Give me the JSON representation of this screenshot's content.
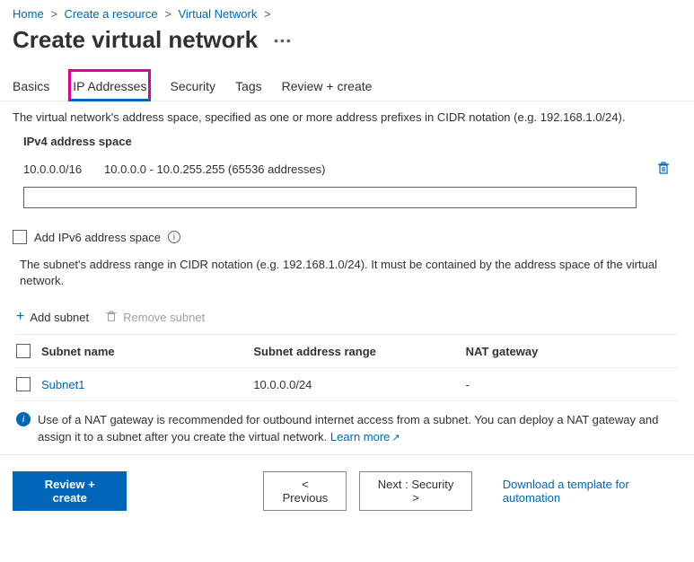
{
  "breadcrumb": {
    "items": [
      "Home",
      "Create a resource",
      "Virtual Network"
    ]
  },
  "page": {
    "title": "Create virtual network"
  },
  "tabs": {
    "items": [
      "Basics",
      "IP Addresses",
      "Security",
      "Tags",
      "Review + create"
    ],
    "active_index": 1
  },
  "ip_section": {
    "description": "The virtual network's address space, specified as one or more address prefixes in CIDR notation (e.g. 192.168.1.0/24).",
    "label": "IPv4 address space",
    "addr_cidr": "10.0.0.0/16",
    "addr_range": "10.0.0.0 - 10.0.255.255 (65536 addresses)",
    "new_addr_value": "",
    "ipv6_checkbox_label": "Add IPv6 address space"
  },
  "subnet_section": {
    "description": "The subnet's address range in CIDR notation (e.g. 192.168.1.0/24). It must be contained by the address space of the virtual network.",
    "add_label": "Add subnet",
    "remove_label": "Remove subnet",
    "columns": {
      "name": "Subnet name",
      "range": "Subnet address range",
      "nat": "NAT gateway"
    },
    "rows": [
      {
        "name": "Subnet1",
        "range": "10.0.0.0/24",
        "nat": "-"
      }
    ]
  },
  "info_banner": {
    "text": "Use of a NAT gateway is recommended for outbound internet access from a subnet. You can deploy a NAT gateway and assign it to a subnet after you create the virtual network.",
    "learn_more": "Learn more"
  },
  "footer": {
    "review": "Review + create",
    "previous": "< Previous",
    "next": "Next : Security >",
    "download": "Download a template for automation"
  }
}
